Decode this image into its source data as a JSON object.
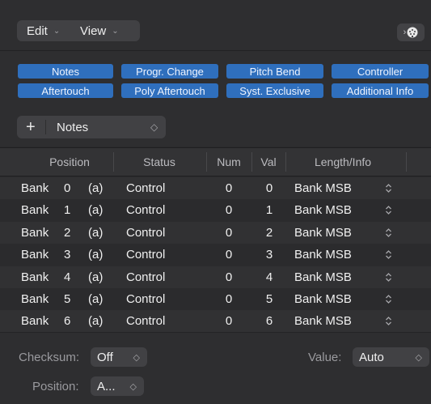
{
  "toolbar": {
    "menus": [
      {
        "label": "Edit",
        "chevron": "⌄"
      },
      {
        "label": "View",
        "chevron": "⌄"
      }
    ],
    "midi_button": {
      "arrow": "›",
      "icon": "midi-connector-icon"
    }
  },
  "filters": {
    "color": "#2f6fbd",
    "row1": [
      "Notes",
      "Progr. Change",
      "Pitch Bend",
      "Controller"
    ],
    "row2": [
      "Aftertouch",
      "Poly Aftertouch",
      "Syst. Exclusive",
      "Additional Info"
    ]
  },
  "create": {
    "plus": "+",
    "label": "Notes",
    "chevron": "◇"
  },
  "table": {
    "headers": {
      "position": "Position",
      "status": "Status",
      "num": "Num",
      "val": "Val",
      "length": "Length/Info"
    },
    "rows": [
      {
        "bank": "Bank",
        "idx": "0",
        "ch": "(a)",
        "status": "Control",
        "num": "0",
        "val": "0",
        "info": "Bank MSB"
      },
      {
        "bank": "Bank",
        "idx": "1",
        "ch": "(a)",
        "status": "Control",
        "num": "0",
        "val": "1",
        "info": "Bank MSB"
      },
      {
        "bank": "Bank",
        "idx": "2",
        "ch": "(a)",
        "status": "Control",
        "num": "0",
        "val": "2",
        "info": "Bank MSB"
      },
      {
        "bank": "Bank",
        "idx": "3",
        "ch": "(a)",
        "status": "Control",
        "num": "0",
        "val": "3",
        "info": "Bank MSB"
      },
      {
        "bank": "Bank",
        "idx": "4",
        "ch": "(a)",
        "status": "Control",
        "num": "0",
        "val": "4",
        "info": "Bank MSB"
      },
      {
        "bank": "Bank",
        "idx": "5",
        "ch": "(a)",
        "status": "Control",
        "num": "0",
        "val": "5",
        "info": "Bank MSB"
      },
      {
        "bank": "Bank",
        "idx": "6",
        "ch": "(a)",
        "status": "Control",
        "num": "0",
        "val": "6",
        "info": "Bank MSB"
      }
    ],
    "stepper_glyph": "⌃⌄"
  },
  "footer": {
    "checksum_label": "Checksum:",
    "checksum_value": "Off",
    "value_label": "Value:",
    "value_value": "Auto",
    "position_label": "Position:",
    "position_value": "A...",
    "stepper": "◇"
  }
}
